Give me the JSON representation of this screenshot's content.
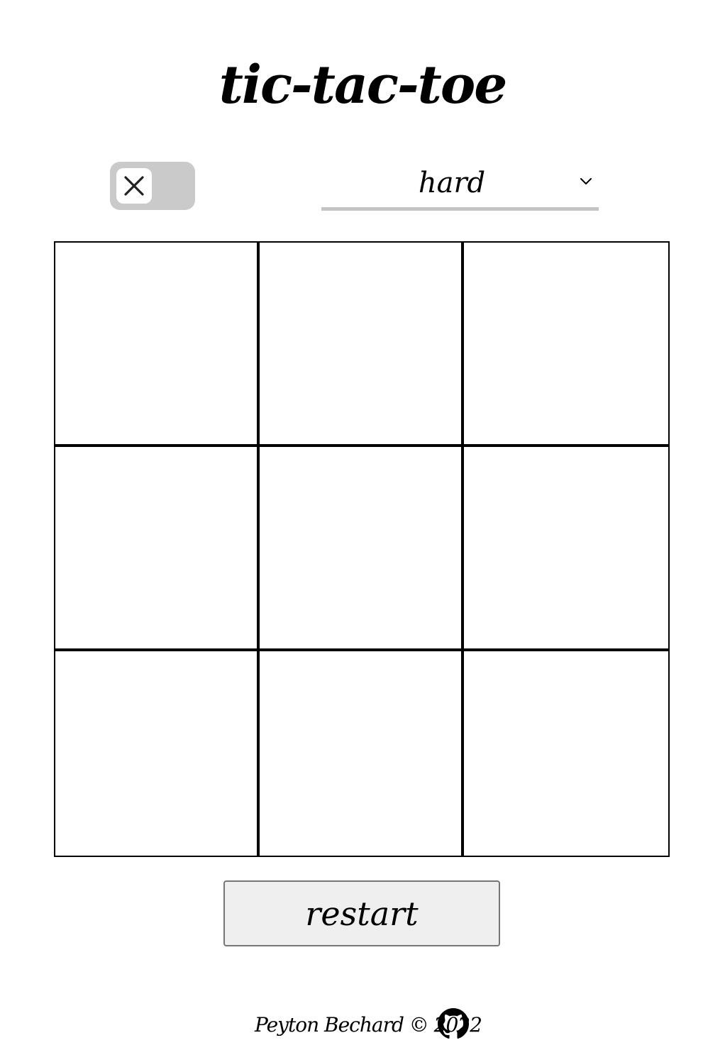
{
  "app": {
    "title": "tic-tac-toe"
  },
  "controls": {
    "player_toggle": {
      "selected": "X",
      "icon": "x-icon"
    },
    "difficulty": {
      "selected": "hard"
    }
  },
  "board": {
    "cells": [
      "",
      "",
      "",
      "",
      "",
      "",
      "",
      "",
      ""
    ]
  },
  "actions": {
    "restart_label": "restart"
  },
  "footer": {
    "text": "Peyton Bechard © 2022",
    "github_icon": "github-icon"
  }
}
